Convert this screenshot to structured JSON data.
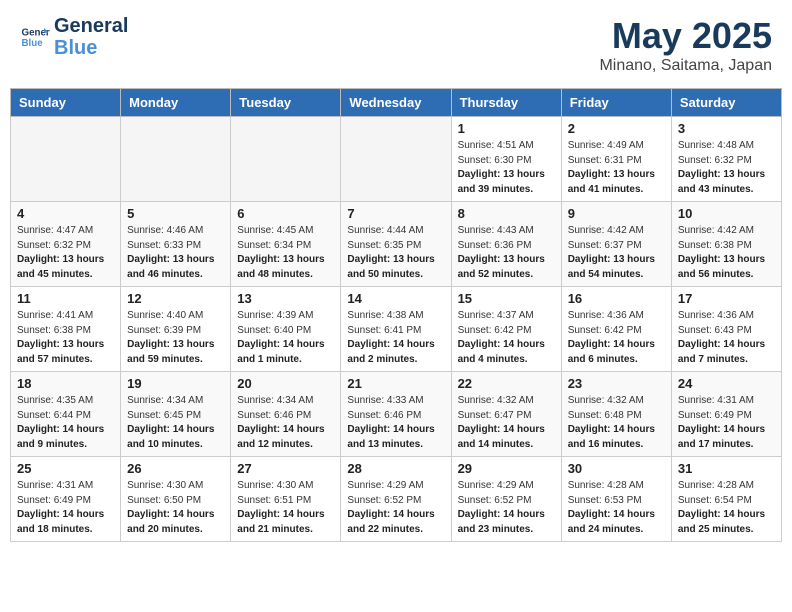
{
  "header": {
    "logo_line1": "General",
    "logo_line2": "Blue",
    "month": "May 2025",
    "location": "Minano, Saitama, Japan"
  },
  "weekdays": [
    "Sunday",
    "Monday",
    "Tuesday",
    "Wednesday",
    "Thursday",
    "Friday",
    "Saturday"
  ],
  "weeks": [
    [
      {
        "day": "",
        "info": ""
      },
      {
        "day": "",
        "info": ""
      },
      {
        "day": "",
        "info": ""
      },
      {
        "day": "",
        "info": ""
      },
      {
        "day": "1",
        "sunrise": "4:51 AM",
        "sunset": "6:30 PM",
        "daylight": "13 hours and 39 minutes."
      },
      {
        "day": "2",
        "sunrise": "4:49 AM",
        "sunset": "6:31 PM",
        "daylight": "13 hours and 41 minutes."
      },
      {
        "day": "3",
        "sunrise": "4:48 AM",
        "sunset": "6:32 PM",
        "daylight": "13 hours and 43 minutes."
      }
    ],
    [
      {
        "day": "4",
        "sunrise": "4:47 AM",
        "sunset": "6:32 PM",
        "daylight": "13 hours and 45 minutes."
      },
      {
        "day": "5",
        "sunrise": "4:46 AM",
        "sunset": "6:33 PM",
        "daylight": "13 hours and 46 minutes."
      },
      {
        "day": "6",
        "sunrise": "4:45 AM",
        "sunset": "6:34 PM",
        "daylight": "13 hours and 48 minutes."
      },
      {
        "day": "7",
        "sunrise": "4:44 AM",
        "sunset": "6:35 PM",
        "daylight": "13 hours and 50 minutes."
      },
      {
        "day": "8",
        "sunrise": "4:43 AM",
        "sunset": "6:36 PM",
        "daylight": "13 hours and 52 minutes."
      },
      {
        "day": "9",
        "sunrise": "4:42 AM",
        "sunset": "6:37 PM",
        "daylight": "13 hours and 54 minutes."
      },
      {
        "day": "10",
        "sunrise": "4:42 AM",
        "sunset": "6:38 PM",
        "daylight": "13 hours and 56 minutes."
      }
    ],
    [
      {
        "day": "11",
        "sunrise": "4:41 AM",
        "sunset": "6:38 PM",
        "daylight": "13 hours and 57 minutes."
      },
      {
        "day": "12",
        "sunrise": "4:40 AM",
        "sunset": "6:39 PM",
        "daylight": "13 hours and 59 minutes."
      },
      {
        "day": "13",
        "sunrise": "4:39 AM",
        "sunset": "6:40 PM",
        "daylight": "14 hours and 1 minute."
      },
      {
        "day": "14",
        "sunrise": "4:38 AM",
        "sunset": "6:41 PM",
        "daylight": "14 hours and 2 minutes."
      },
      {
        "day": "15",
        "sunrise": "4:37 AM",
        "sunset": "6:42 PM",
        "daylight": "14 hours and 4 minutes."
      },
      {
        "day": "16",
        "sunrise": "4:36 AM",
        "sunset": "6:42 PM",
        "daylight": "14 hours and 6 minutes."
      },
      {
        "day": "17",
        "sunrise": "4:36 AM",
        "sunset": "6:43 PM",
        "daylight": "14 hours and 7 minutes."
      }
    ],
    [
      {
        "day": "18",
        "sunrise": "4:35 AM",
        "sunset": "6:44 PM",
        "daylight": "14 hours and 9 minutes."
      },
      {
        "day": "19",
        "sunrise": "4:34 AM",
        "sunset": "6:45 PM",
        "daylight": "14 hours and 10 minutes."
      },
      {
        "day": "20",
        "sunrise": "4:34 AM",
        "sunset": "6:46 PM",
        "daylight": "14 hours and 12 minutes."
      },
      {
        "day": "21",
        "sunrise": "4:33 AM",
        "sunset": "6:46 PM",
        "daylight": "14 hours and 13 minutes."
      },
      {
        "day": "22",
        "sunrise": "4:32 AM",
        "sunset": "6:47 PM",
        "daylight": "14 hours and 14 minutes."
      },
      {
        "day": "23",
        "sunrise": "4:32 AM",
        "sunset": "6:48 PM",
        "daylight": "14 hours and 16 minutes."
      },
      {
        "day": "24",
        "sunrise": "4:31 AM",
        "sunset": "6:49 PM",
        "daylight": "14 hours and 17 minutes."
      }
    ],
    [
      {
        "day": "25",
        "sunrise": "4:31 AM",
        "sunset": "6:49 PM",
        "daylight": "14 hours and 18 minutes."
      },
      {
        "day": "26",
        "sunrise": "4:30 AM",
        "sunset": "6:50 PM",
        "daylight": "14 hours and 20 minutes."
      },
      {
        "day": "27",
        "sunrise": "4:30 AM",
        "sunset": "6:51 PM",
        "daylight": "14 hours and 21 minutes."
      },
      {
        "day": "28",
        "sunrise": "4:29 AM",
        "sunset": "6:52 PM",
        "daylight": "14 hours and 22 minutes."
      },
      {
        "day": "29",
        "sunrise": "4:29 AM",
        "sunset": "6:52 PM",
        "daylight": "14 hours and 23 minutes."
      },
      {
        "day": "30",
        "sunrise": "4:28 AM",
        "sunset": "6:53 PM",
        "daylight": "14 hours and 24 minutes."
      },
      {
        "day": "31",
        "sunrise": "4:28 AM",
        "sunset": "6:54 PM",
        "daylight": "14 hours and 25 minutes."
      }
    ]
  ]
}
